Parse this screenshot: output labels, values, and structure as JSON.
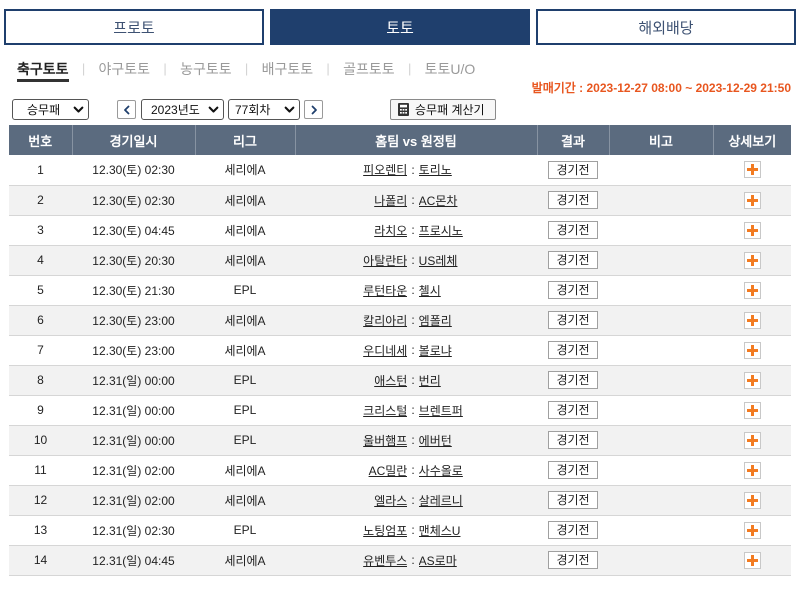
{
  "top_tabs": [
    {
      "label": "프로토",
      "active": false
    },
    {
      "label": "토토",
      "active": true
    },
    {
      "label": "해외배당",
      "active": false
    }
  ],
  "sport_tabs": {
    "items": [
      "축구토토",
      "야구토토",
      "농구토토",
      "배구토토",
      "골프토토",
      "토토U/O"
    ],
    "separator": "|",
    "active_index": 0
  },
  "sale_period": "발매기간 : 2023-12-27 08:00 ~ 2023-12-29 21:50",
  "controls": {
    "game_type": {
      "selected": "승무패",
      "icon": "chevron-down-icon"
    },
    "prev_button_icon": "chevron-left-icon",
    "year": {
      "selected": "2023년도",
      "icon": "chevron-down-icon"
    },
    "round": {
      "selected": "77회차",
      "icon": "chevron-down-icon"
    },
    "next_button_icon": "chevron-right-icon",
    "calculator": {
      "label": "승무패 계산기",
      "icon": "calculator-icon"
    }
  },
  "table": {
    "columns": [
      "번호",
      "경기일시",
      "리그",
      "홈팀 vs 원정팀",
      "결과",
      "비고",
      "상세보기"
    ],
    "team_separator": ":",
    "detail_icon": "plus-icon",
    "rows": [
      {
        "no": 1,
        "datetime": "12.30(토) 02:30",
        "league": "세리에A",
        "home": "피오렌티",
        "away": "토리노",
        "result": "경기전"
      },
      {
        "no": 2,
        "datetime": "12.30(토) 02:30",
        "league": "세리에A",
        "home": "나폴리",
        "away": "AC몬차",
        "result": "경기전"
      },
      {
        "no": 3,
        "datetime": "12.30(토) 04:45",
        "league": "세리에A",
        "home": "라치오",
        "away": "프로시노",
        "result": "경기전"
      },
      {
        "no": 4,
        "datetime": "12.30(토) 20:30",
        "league": "세리에A",
        "home": "아탈란타",
        "away": "US레체",
        "result": "경기전"
      },
      {
        "no": 5,
        "datetime": "12.30(토) 21:30",
        "league": "EPL",
        "home": "루턴타운",
        "away": "첼시",
        "result": "경기전"
      },
      {
        "no": 6,
        "datetime": "12.30(토) 23:00",
        "league": "세리에A",
        "home": "칼리아리",
        "away": "엠폴리",
        "result": "경기전"
      },
      {
        "no": 7,
        "datetime": "12.30(토) 23:00",
        "league": "세리에A",
        "home": "우디네세",
        "away": "볼로냐",
        "result": "경기전"
      },
      {
        "no": 8,
        "datetime": "12.31(일) 00:00",
        "league": "EPL",
        "home": "애스턴",
        "away": "번리",
        "result": "경기전"
      },
      {
        "no": 9,
        "datetime": "12.31(일) 00:00",
        "league": "EPL",
        "home": "크리스털",
        "away": "브렌트퍼",
        "result": "경기전"
      },
      {
        "no": 10,
        "datetime": "12.31(일) 00:00",
        "league": "EPL",
        "home": "울버햄프",
        "away": "에버턴",
        "result": "경기전"
      },
      {
        "no": 11,
        "datetime": "12.31(일) 02:00",
        "league": "세리에A",
        "home": "AC밀란",
        "away": "사수올로",
        "result": "경기전"
      },
      {
        "no": 12,
        "datetime": "12.31(일) 02:00",
        "league": "세리에A",
        "home": "엘라스",
        "away": "살레르니",
        "result": "경기전"
      },
      {
        "no": 13,
        "datetime": "12.31(일) 02:30",
        "league": "EPL",
        "home": "노팅엄포",
        "away": "맨체스U",
        "result": "경기전"
      },
      {
        "no": 14,
        "datetime": "12.31(일) 04:45",
        "league": "세리에A",
        "home": "유벤투스",
        "away": "AS로마",
        "result": "경기전"
      }
    ]
  },
  "colors": {
    "brand_navy": "#1f3f6d",
    "sale_period_text": "#e8561f",
    "table_header_bg": "#5b6b7f",
    "row_alt_bg": "#f2f2f2",
    "detail_plus": "#f27b21"
  }
}
